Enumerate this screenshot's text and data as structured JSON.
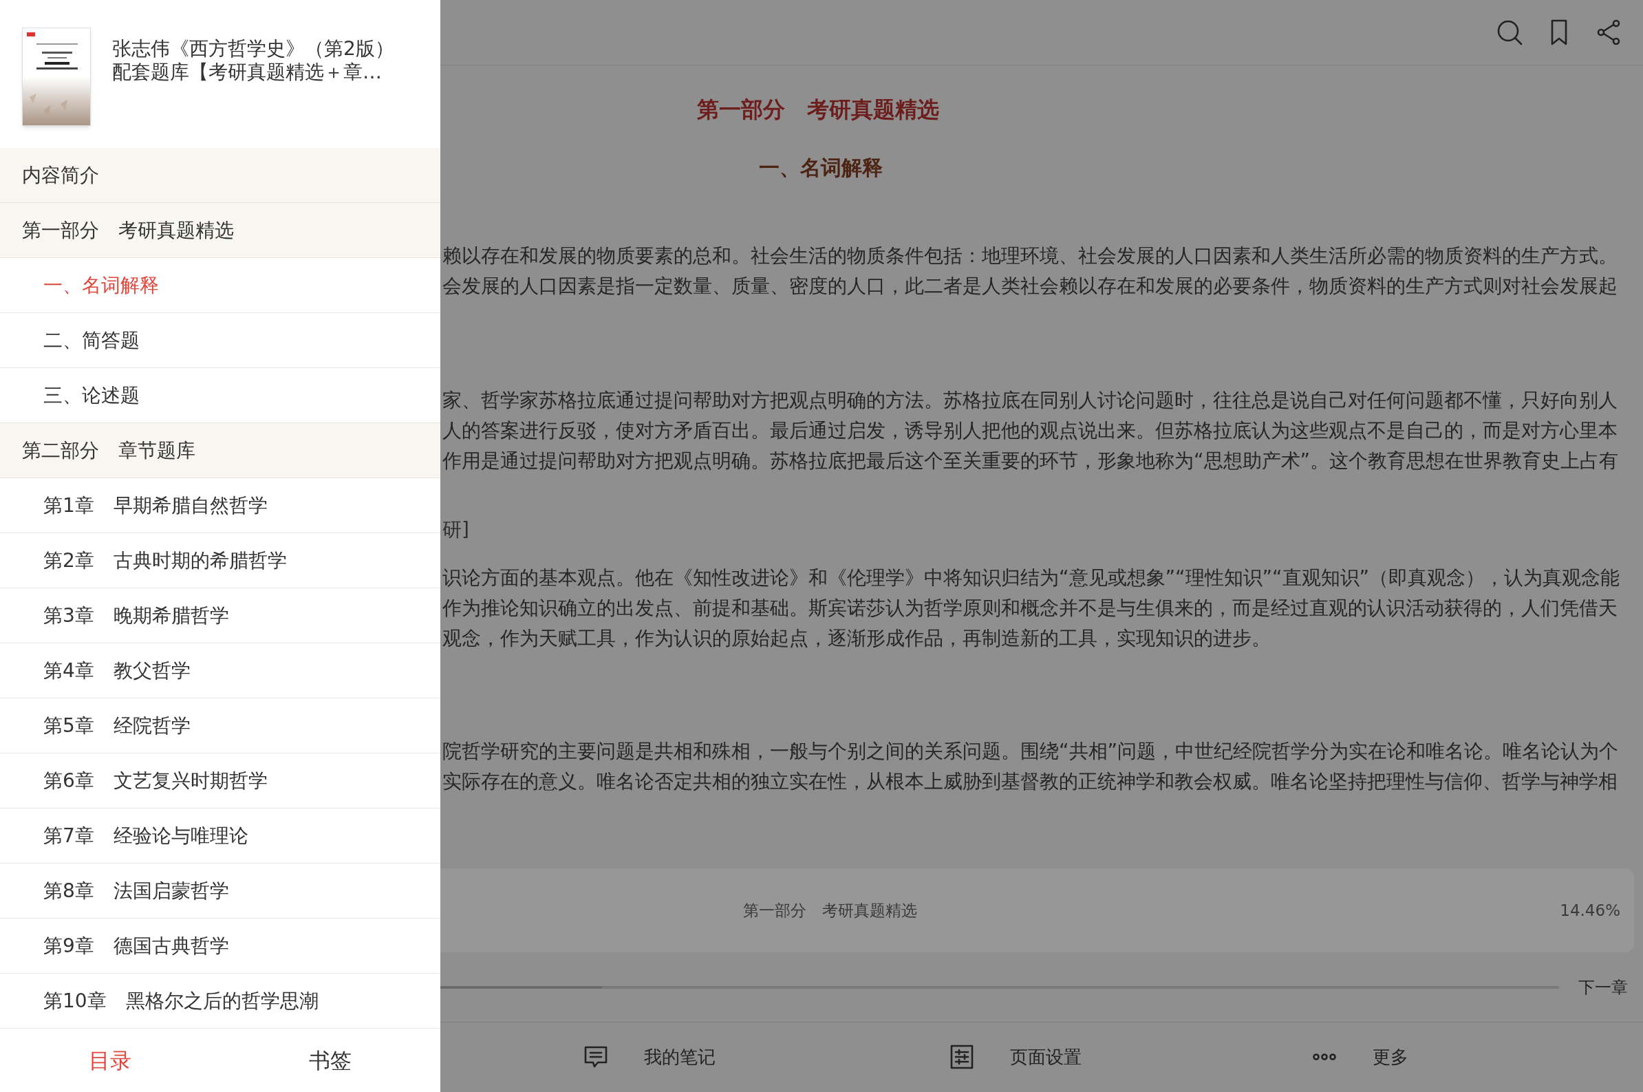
{
  "drawer": {
    "book": {
      "title_lines": [
        "张志伟《西方哲学史》（第2版）",
        "配套题库【考研真题精选＋章…"
      ]
    },
    "toc": [
      {
        "label": "内容简介",
        "selected": false
      },
      {
        "label": "第一部分　考研真题精选",
        "selected": false,
        "children": [
          {
            "label": "一、名词解释",
            "selected": true
          },
          {
            "label": "二、简答题",
            "selected": false
          },
          {
            "label": "三、论述题",
            "selected": false
          }
        ]
      },
      {
        "label": "第二部分　章节题库",
        "selected": false,
        "children": [
          {
            "label": "第1章　早期希腊自然哲学",
            "selected": false
          },
          {
            "label": "第2章　古典时期的希腊哲学",
            "selected": false
          },
          {
            "label": "第3章　晚期希腊哲学",
            "selected": false
          },
          {
            "label": "第4章　教父哲学",
            "selected": false
          },
          {
            "label": "第5章　经院哲学",
            "selected": false
          },
          {
            "label": "第6章　文艺复兴时期哲学",
            "selected": false
          },
          {
            "label": "第7章　经验论与唯理论",
            "selected": false
          },
          {
            "label": "第8章　法国启蒙哲学",
            "selected": false
          },
          {
            "label": "第9章　德国古典哲学",
            "selected": false
          },
          {
            "label": "第10章　黑格尔之后的哲学思潮",
            "selected": false
          }
        ]
      }
    ],
    "tabs": [
      {
        "label": "目录",
        "selected": true
      },
      {
        "label": "书签",
        "selected": false
      }
    ]
  },
  "reader": {
    "heading": "第一部分　考研真题精选",
    "subheading": "一、名词解释",
    "blocks": [
      {
        "kind": "paragraph",
        "lines": [
          "赖以存在和发展的物质要素的总和。社会生活的物质条件包括：地理环境、社会发展的人口因素和人类生活所必需的物质资料的生产方式。",
          "会发展的人口因素是指一定数量、质量、密度的人口，此二者是人类社会赖以存在和发展的必要条件，物质资料的生产方式则对社会发展起"
        ]
      },
      {
        "kind": "paragraph",
        "lines": [
          "家、哲学家苏格拉底通过提问帮助对方把观点明确的方法。苏格拉底在同别人讨论问题时，往往总是说自己对任何问题都不懂，只好向别人",
          "人的答案进行反驳，使对方矛盾百出。最后通过启发，诱导别人把他的观点说出来。但苏格拉底认为这些观点不是自己的，而是对方心里本",
          "作用是通过提问帮助对方把观点明确。苏格拉底把最后这个至关重要的环节，形象地称为“思想助产术”。这个教育思想在世界教育史上占有"
        ]
      },
      {
        "kind": "source",
        "lines": [
          "研]"
        ]
      },
      {
        "kind": "paragraph",
        "lines": [
          "识论方面的基本观点。他在《知性改进论》和《伦理学》中将知识归结为“意见或想象”“理性知识”“直观知识”（即真观念），认为真观念能",
          "作为推论知识确立的出发点、前提和基础。斯宾诺莎认为哲学原则和概念并不是与生俱来的，而是经过直观的认识活动获得的，人们凭借天",
          "观念，作为天赋工具，作为认识的原始起点，逐渐形成作品，再制造新的工具，实现知识的进步。"
        ]
      },
      {
        "kind": "paragraph",
        "lines": [
          "院哲学研究的主要问题是共相和殊相，一般与个别之间的关系问题。围绕“共相”问题，中世纪经院哲学分为实在论和唯名论。唯名论认为个",
          "实际存在的意义。唯名论否定共相的独立实在性，从根本上威胁到基督教的正统神学和教会权威。唯名论坚持把理性与信仰、哲学与神学相"
        ]
      }
    ],
    "location": {
      "chapter": "第一部分　考研真题精选",
      "percent": "14.46%",
      "level": 0.1446
    },
    "next_chapter": "下一章",
    "toolbar": [
      {
        "kind": "notes",
        "label": "我的笔记"
      },
      {
        "kind": "settings",
        "label": "页面设置"
      },
      {
        "kind": "more",
        "label": "更多"
      }
    ]
  }
}
